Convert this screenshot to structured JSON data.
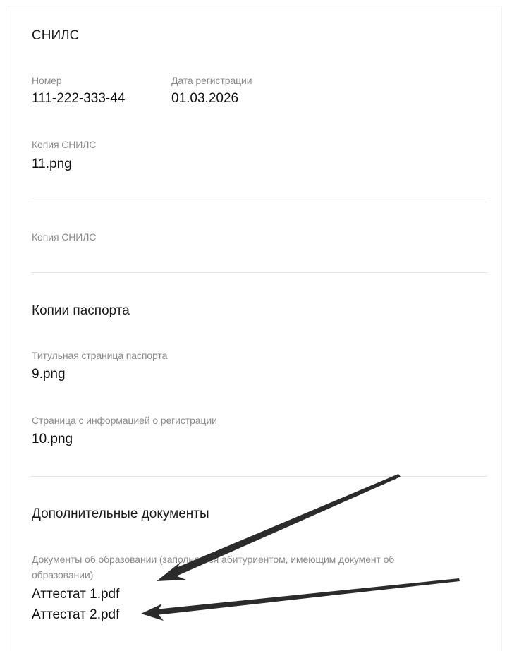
{
  "snils": {
    "title": "СНИЛС",
    "number_label": "Номер",
    "number_value": "111-222-333-44",
    "date_label": "Дата регистрации",
    "date_value": "01.03.2026",
    "copy_label": "Копия СНИЛС",
    "copy_file": "11.png",
    "copy_label_2": "Копия СНИЛС"
  },
  "passport": {
    "title": "Копии паспорта",
    "title_page_label": "Титульная страница паспорта",
    "title_page_file": "9.png",
    "registration_label": "Страница с информацией о регистрации",
    "registration_file": "10.png"
  },
  "additional": {
    "title": "Дополнительные документы",
    "education_label": "Документы об образовании (заполняется абитуриентом, имеющим документ об образовании)",
    "files": [
      "Аттестат 1.pdf",
      "Аттестат 2.pdf"
    ]
  },
  "colors": {
    "label": "#8a8a8a",
    "value": "#111111",
    "divider": "#e3e3e3",
    "arrow": "#2b2b2b"
  }
}
